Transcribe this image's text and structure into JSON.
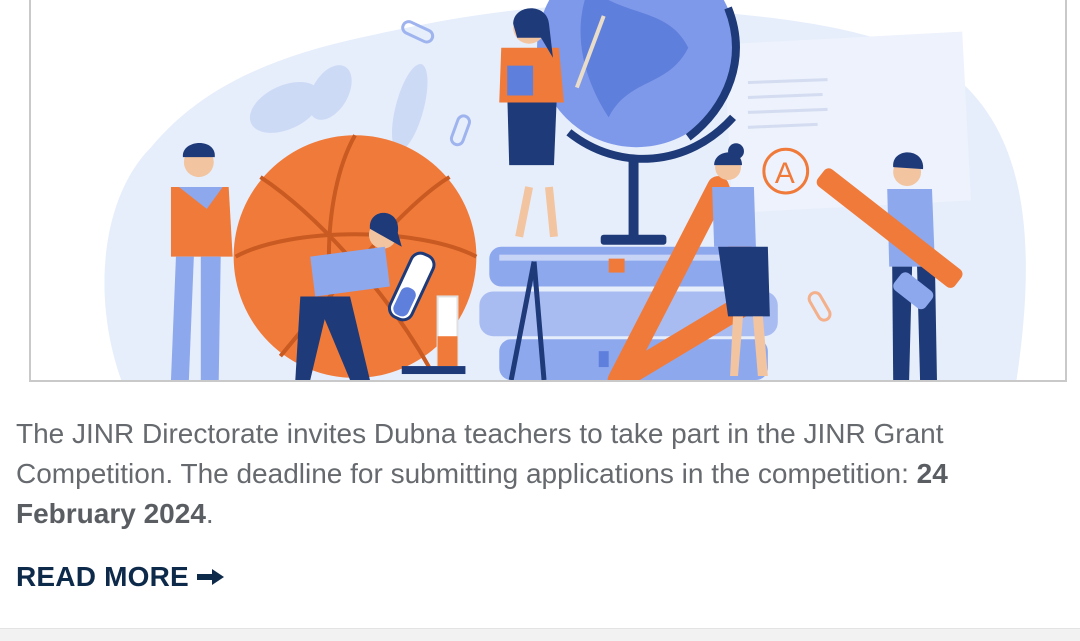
{
  "article": {
    "image_alt": "",
    "excerpt_text": "The JINR Directorate invites Dubna teachers to take part in the JINR Grant Competition. The deadline for submitting applications in the competition: ",
    "excerpt_deadline": "24 February 2024",
    "excerpt_end": ".",
    "read_more_label": "READ MORE",
    "read_more_icon": "arrow-right-icon"
  },
  "illustration": {
    "grade_letter": "A",
    "colors": {
      "orange": "#f07a3a",
      "navy": "#1e3a78",
      "light_blue": "#8ea8ee",
      "pale_blue": "#e6eefb",
      "skin": "#f2c4a0"
    }
  },
  "colors": {
    "text": "#666a6e",
    "link": "#0e2a4a",
    "border": "#c9c9c9"
  }
}
